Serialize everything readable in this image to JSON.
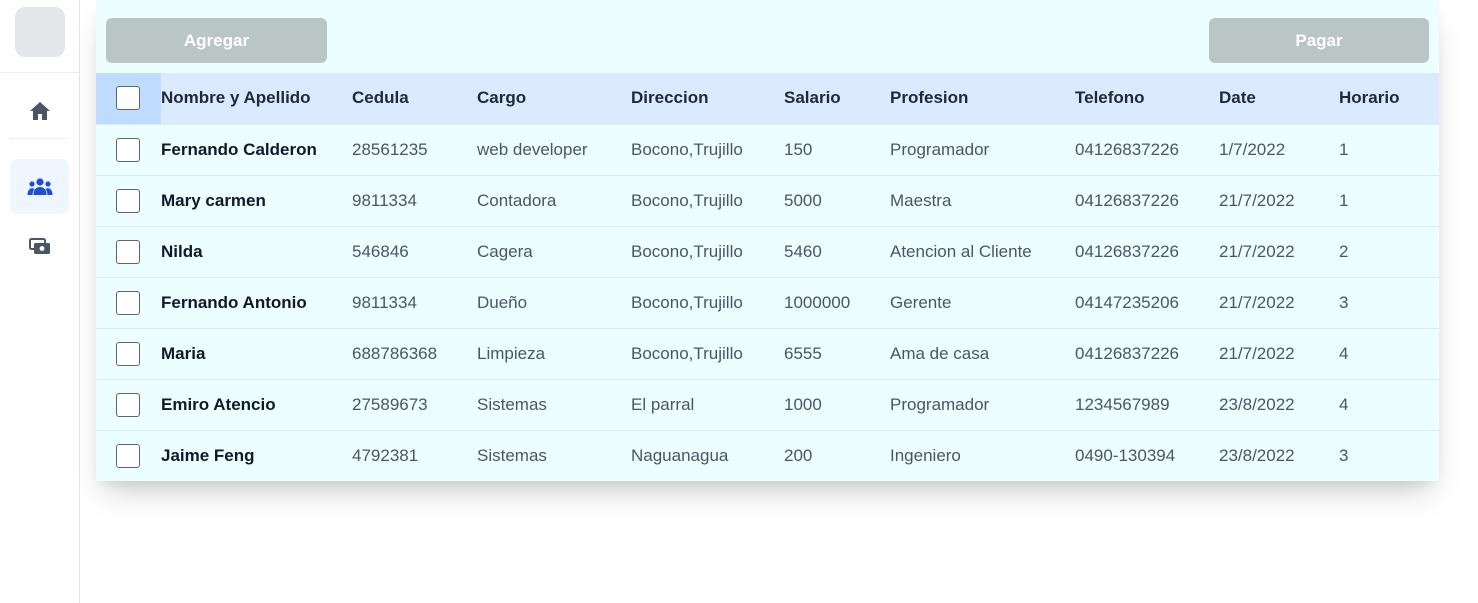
{
  "toolbar": {
    "add_label": "Agregar",
    "pay_label": "Pagar"
  },
  "sidebar": {
    "items": [
      {
        "icon": "home-icon",
        "active": false
      },
      {
        "icon": "users-icon",
        "active": true
      },
      {
        "icon": "money-icon",
        "active": false
      }
    ]
  },
  "table": {
    "columns": [
      "Nombre y Apellido",
      "Cedula",
      "Cargo",
      "Direccion",
      "Salario",
      "Profesion",
      "Telefono",
      "Date",
      "Horario"
    ],
    "rows": [
      [
        "Fernando Calderon",
        "28561235",
        "web developer",
        "Bocono,Trujillo",
        "150",
        "Programador",
        "04126837226",
        "1/7/2022",
        "1"
      ],
      [
        "Mary carmen",
        "9811334",
        "Contadora",
        "Bocono,Trujillo",
        "5000",
        "Maestra",
        "04126837226",
        "21/7/2022",
        "1"
      ],
      [
        "Nilda",
        "546846",
        "Cagera",
        "Bocono,Trujillo",
        "5460",
        "Atencion al Cliente",
        "04126837226",
        "21/7/2022",
        "2"
      ],
      [
        "Fernando Antonio",
        "9811334",
        "Dueño",
        "Bocono,Trujillo",
        "1000000",
        "Gerente",
        "04147235206",
        "21/7/2022",
        "3"
      ],
      [
        "Maria",
        "688786368",
        "Limpieza",
        "Bocono,Trujillo",
        "6555",
        "Ama de casa",
        "04126837226",
        "21/7/2022",
        "4"
      ],
      [
        "Emiro Atencio",
        "27589673",
        "Sistemas",
        "El parral",
        "1000",
        "Programador",
        "1234567989",
        "23/8/2022",
        "4"
      ],
      [
        "Jaime Feng",
        "4792381",
        "Sistemas",
        "Naguanagua",
        "200",
        "Ingeniero",
        "0490-130394",
        "23/8/2022",
        "3"
      ]
    ]
  },
  "colors": {
    "card_bg": "#ecfeff",
    "header_bg": "#dbeafe",
    "button_bg": "#bac6c6",
    "active_nav_bg": "#eff6ff",
    "accent_icon": "#1d4ed8"
  }
}
